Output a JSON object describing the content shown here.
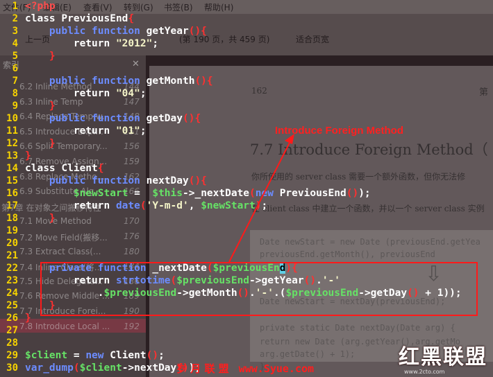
{
  "background_viewer": {
    "menu": [
      "文件(F)",
      "编辑(E)",
      "查看(V)",
      "转到(G)",
      "书签(B)",
      "帮助(H)"
    ],
    "toolbar": {
      "prev_label": "上一页",
      "page_info": "(第 190 页，共 459 页)",
      "zoom_select": "适合页宽"
    },
    "sidebar": {
      "header": "索引",
      "items": [
        {
          "label": "6.2 Inline Method",
          "page": "144"
        },
        {
          "label": "6.3 Inline Temp",
          "page": "147"
        },
        {
          "label": "6.4 Replace Temp w...",
          "page": "148"
        },
        {
          "label": "6.5 Introduce Expl...",
          "page": "151"
        },
        {
          "label": "6.6 Split Temporary...",
          "page": "156"
        },
        {
          "label": "6.7 Remove Assign...",
          "page": "159"
        },
        {
          "label": "6.8 Replace Metho...",
          "page": "162"
        },
        {
          "label": "6.9 Substitute Alg...",
          "page": "166"
        },
        {
          "label": "第7章 在对象之间搬移特性",
          "page": ""
        },
        {
          "label": "7.1 Move Method",
          "page": "170"
        },
        {
          "label": "7.2 Move Field(搬移...",
          "page": "176"
        },
        {
          "label": "7.3 Extract Class(...",
          "page": "180"
        },
        {
          "label": "7.4 Inline Class(将...",
          "page": "184"
        },
        {
          "label": "7.5 Hide Delegate...",
          "page": "186"
        },
        {
          "label": "7.6 Remove Middle ...",
          "page": "189"
        },
        {
          "label": "7.7 Introduce Forei...",
          "page": "190"
        },
        {
          "label": "7.8 Introduce Local ...",
          "page": "192"
        }
      ]
    },
    "pdf_page": {
      "page_number": "162",
      "chapter_marker": "第",
      "heading": "7.7  Introduce Foreign Method（",
      "para1": "你所使用的 server class 需要一个额外函数，但你无法修",
      "para2": "在 client class 中建立一个函数，并以一个 server class 实例",
      "code_lines": [
        "Date newStart = new Date (previousEnd.getYea",
        "        previousEnd.getMonth(), previousEnd",
        "Date newStart = nextDay(previousEnd);",
        "private static Date nextDay(Date arg) {",
        "  return new Date (arg.getYear(),arg.getMo",
        "          arg.getDate() + 1);",
        "}"
      ]
    }
  },
  "editor": {
    "lines": [
      {
        "n": "1",
        "tokens": [
          [
            "kw",
            "<?php"
          ]
        ]
      },
      {
        "n": "2",
        "tokens": [
          [
            "plain",
            "class PreviousEnd"
          ],
          [
            "brace",
            "{"
          ]
        ]
      },
      {
        "n": "3",
        "tokens": [
          [
            "plain",
            "    "
          ],
          [
            "kw2",
            "public function"
          ],
          [
            "plain",
            " getYear"
          ],
          [
            "brace",
            "(){"
          ]
        ]
      },
      {
        "n": "4",
        "tokens": [
          [
            "plain",
            "        return "
          ],
          [
            "str",
            "\"2012\""
          ],
          [
            "plain",
            ";"
          ]
        ]
      },
      {
        "n": "5",
        "tokens": [
          [
            "plain",
            "    "
          ],
          [
            "brace",
            "}"
          ]
        ]
      },
      {
        "n": "6",
        "tokens": []
      },
      {
        "n": "7",
        "tokens": [
          [
            "plain",
            "    "
          ],
          [
            "kw2",
            "public function"
          ],
          [
            "plain",
            " getMonth"
          ],
          [
            "brace",
            "(){"
          ]
        ]
      },
      {
        "n": "8",
        "tokens": [
          [
            "plain",
            "        return "
          ],
          [
            "str",
            "\"04\""
          ],
          [
            "plain",
            ";"
          ]
        ]
      },
      {
        "n": "9",
        "tokens": [
          [
            "plain",
            "    "
          ],
          [
            "brace",
            "}"
          ]
        ]
      },
      {
        "n": "10",
        "tokens": [
          [
            "plain",
            "    "
          ],
          [
            "kw2",
            "public function"
          ],
          [
            "plain",
            " getDay"
          ],
          [
            "brace",
            "(){"
          ]
        ]
      },
      {
        "n": "11",
        "tokens": [
          [
            "plain",
            "        return "
          ],
          [
            "str",
            "\"01\""
          ],
          [
            "plain",
            ";"
          ]
        ]
      },
      {
        "n": "12",
        "tokens": [
          [
            "plain",
            "    "
          ],
          [
            "brace",
            "}"
          ]
        ]
      },
      {
        "n": "13",
        "tokens": [
          [
            "brace",
            "}"
          ]
        ]
      },
      {
        "n": "14",
        "tokens": [
          [
            "plain",
            "class Client"
          ],
          [
            "brace",
            "{"
          ]
        ]
      },
      {
        "n": "15",
        "tokens": [
          [
            "plain",
            "    "
          ],
          [
            "kw2",
            "public function"
          ],
          [
            "plain",
            " nextDay"
          ],
          [
            "brace",
            "(){"
          ]
        ]
      },
      {
        "n": "16",
        "tokens": [
          [
            "plain",
            "        "
          ],
          [
            "var",
            "$newStart"
          ],
          [
            "plain",
            " =  "
          ],
          [
            "var",
            "$this"
          ],
          [
            "plain",
            "->_nextDate"
          ],
          [
            "brace",
            "("
          ],
          [
            "kw2",
            "new"
          ],
          [
            "plain",
            " PreviousEnd"
          ],
          [
            "brace",
            "()"
          ],
          [
            "plain",
            ");"
          ]
        ]
      },
      {
        "n": "17",
        "tokens": [
          [
            "plain",
            "        return "
          ],
          [
            "kw2",
            "date"
          ],
          [
            "brace",
            "("
          ],
          [
            "str",
            "'Y-m-d'"
          ],
          [
            "plain",
            ", "
          ],
          [
            "var",
            "$newStart"
          ],
          [
            "brace",
            ")"
          ],
          [
            "plain",
            ";"
          ]
        ]
      },
      {
        "n": "18",
        "tokens": [
          [
            "plain",
            "    "
          ],
          [
            "brace",
            "}"
          ]
        ]
      },
      {
        "n": "19",
        "tokens": []
      },
      {
        "n": "20",
        "tokens": []
      },
      {
        "n": "21",
        "tokens": []
      },
      {
        "n": "22",
        "tokens": [
          [
            "plain",
            "    "
          ],
          [
            "kw2",
            "private function"
          ],
          [
            "plain",
            " _nextDate"
          ],
          [
            "brace",
            "("
          ],
          [
            "var",
            "$previousEn"
          ],
          [
            "cursor",
            "d"
          ],
          [
            "brace",
            "){"
          ]
        ]
      },
      {
        "n": "23",
        "tokens": [
          [
            "plain",
            "        return "
          ],
          [
            "kw2",
            "strtotime"
          ],
          [
            "brace",
            "("
          ],
          [
            "var",
            "$previousEnd"
          ],
          [
            "plain",
            "->getYear"
          ],
          [
            "brace",
            "()"
          ],
          [
            "plain",
            "."
          ],
          [
            "str",
            "'-'"
          ]
        ]
      },
      {
        "n": "24",
        "tokens": [
          [
            "plain",
            "            ."
          ],
          [
            "var",
            "$previousEnd"
          ],
          [
            "plain",
            "->getMonth"
          ],
          [
            "brace",
            "()"
          ],
          [
            "plain",
            "."
          ],
          [
            "str",
            "'-'"
          ],
          [
            "plain",
            ".("
          ],
          [
            "var",
            "$previousEnd"
          ],
          [
            "plain",
            "->getDay"
          ],
          [
            "brace",
            "()"
          ],
          [
            "plain",
            " + 1));"
          ]
        ]
      },
      {
        "n": "25",
        "tokens": [
          [
            "plain",
            "    "
          ],
          [
            "brace",
            "}"
          ]
        ]
      },
      {
        "n": "26",
        "tokens": [
          [
            "brace",
            "}"
          ]
        ]
      },
      {
        "n": "27",
        "tokens": []
      },
      {
        "n": "28",
        "tokens": []
      },
      {
        "n": "29",
        "tokens": [
          [
            "var",
            "$client"
          ],
          [
            "plain",
            " = "
          ],
          [
            "kw2",
            "new"
          ],
          [
            "plain",
            " Client"
          ],
          [
            "brace",
            "()"
          ],
          [
            "plain",
            ";"
          ]
        ]
      },
      {
        "n": "30",
        "tokens": [
          [
            "kw2",
            "var_dump"
          ],
          [
            "brace",
            "("
          ],
          [
            "var",
            "$client"
          ],
          [
            "plain",
            "->nextDay"
          ],
          [
            "brace",
            "()"
          ],
          [
            "plain",
            ");"
          ]
        ]
      }
    ]
  },
  "annotation": {
    "title": "Introduce Foreign Method"
  },
  "watermark": {
    "site_name": "岁 月 联 盟",
    "site_url": "www.Syue.com",
    "logo_text": "红黑联盟",
    "logo_url": "www.2cto.com"
  },
  "colors": {
    "line_number": "#f7d300",
    "keyword_red": "#ff4d4d",
    "keyword_blue": "#6c8cff",
    "string": "#f4f4c8",
    "variable": "#66e266",
    "brace": "#ff3030",
    "annotation": "#ff1a1a",
    "cursor": "#5fd0e6"
  }
}
